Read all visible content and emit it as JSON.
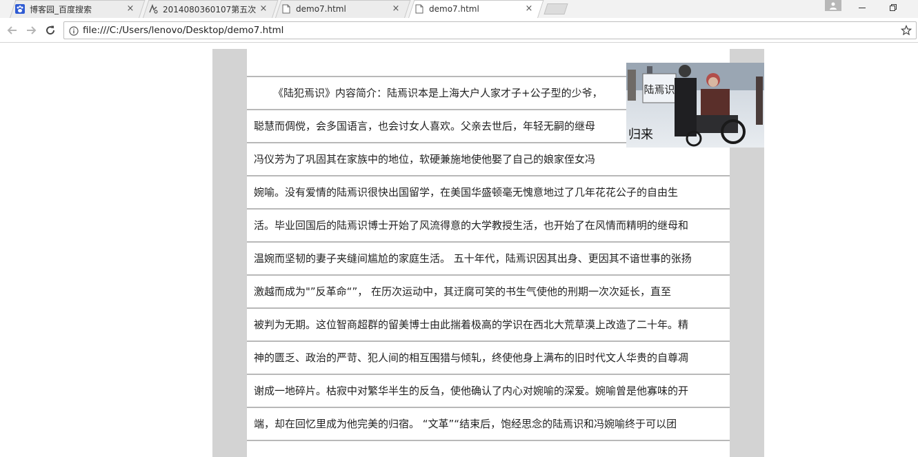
{
  "browser": {
    "tabs": [
      {
        "title": "博客园_百度搜索",
        "favicon": "baidu-paw-icon",
        "close": "×"
      },
      {
        "title": "2014080360107第五次",
        "favicon": "blog-icon",
        "close": "×"
      },
      {
        "title": "demo7.html",
        "favicon": "page-icon",
        "close": "×"
      },
      {
        "title": "demo7.html",
        "favicon": "page-icon",
        "close": "×",
        "active": true
      }
    ],
    "address_url": "file:///C:/Users/lenovo/Desktop/demo7.html"
  },
  "article": {
    "lines": [
      "《陆犯焉识》内容简介：陆焉识本是上海大户人家才子+公子型的少爷，",
      "聪慧而倜傥，会多国语言，也会讨女人喜欢。父亲去世后，年轻无嗣的继母",
      "冯仪芳为了巩固其在家族中的地位，软硬兼施地使他娶了自己的娘家侄女冯",
      "婉喻。没有爱情的陆焉识很快出国留学，在美国华盛顿毫无愧意地过了几年花花公子的自由生",
      "活。毕业回国后的陆焉识博士开始了风流得意的大学教授生活，也开始了在风情而精明的继母和",
      "温婉而坚韧的妻子夹缝间尴尬的家庭生活。 五十年代，陆焉识因其出身、更因其不谙世事的张扬",
      "激越而成为\"”反革命“”， 在历次运动中，其迂腐可笑的书生气使他的刑期一次次延长，直至",
      "被判为无期。这位智商超群的留美博士由此揣着极高的学识在西北大荒草漠上改造了二十年。精",
      "神的匮乏、政治的严苛、犯人间的相互围猎与倾轧，终使他身上满布的旧时代文人华贵的自尊凋",
      "谢成一地碎片。枯寂中对繁华半生的反刍，使他确认了内心对婉喻的深爱。婉喻曾是他寡味的开",
      "端，却在回忆里成为他完美的归宿。 “文革”“结束后，饱经思念的陆焉识和冯婉喻终于可以团"
    ],
    "photo": {
      "sign_text": "陆焉识",
      "calligraphy": "归来"
    }
  }
}
